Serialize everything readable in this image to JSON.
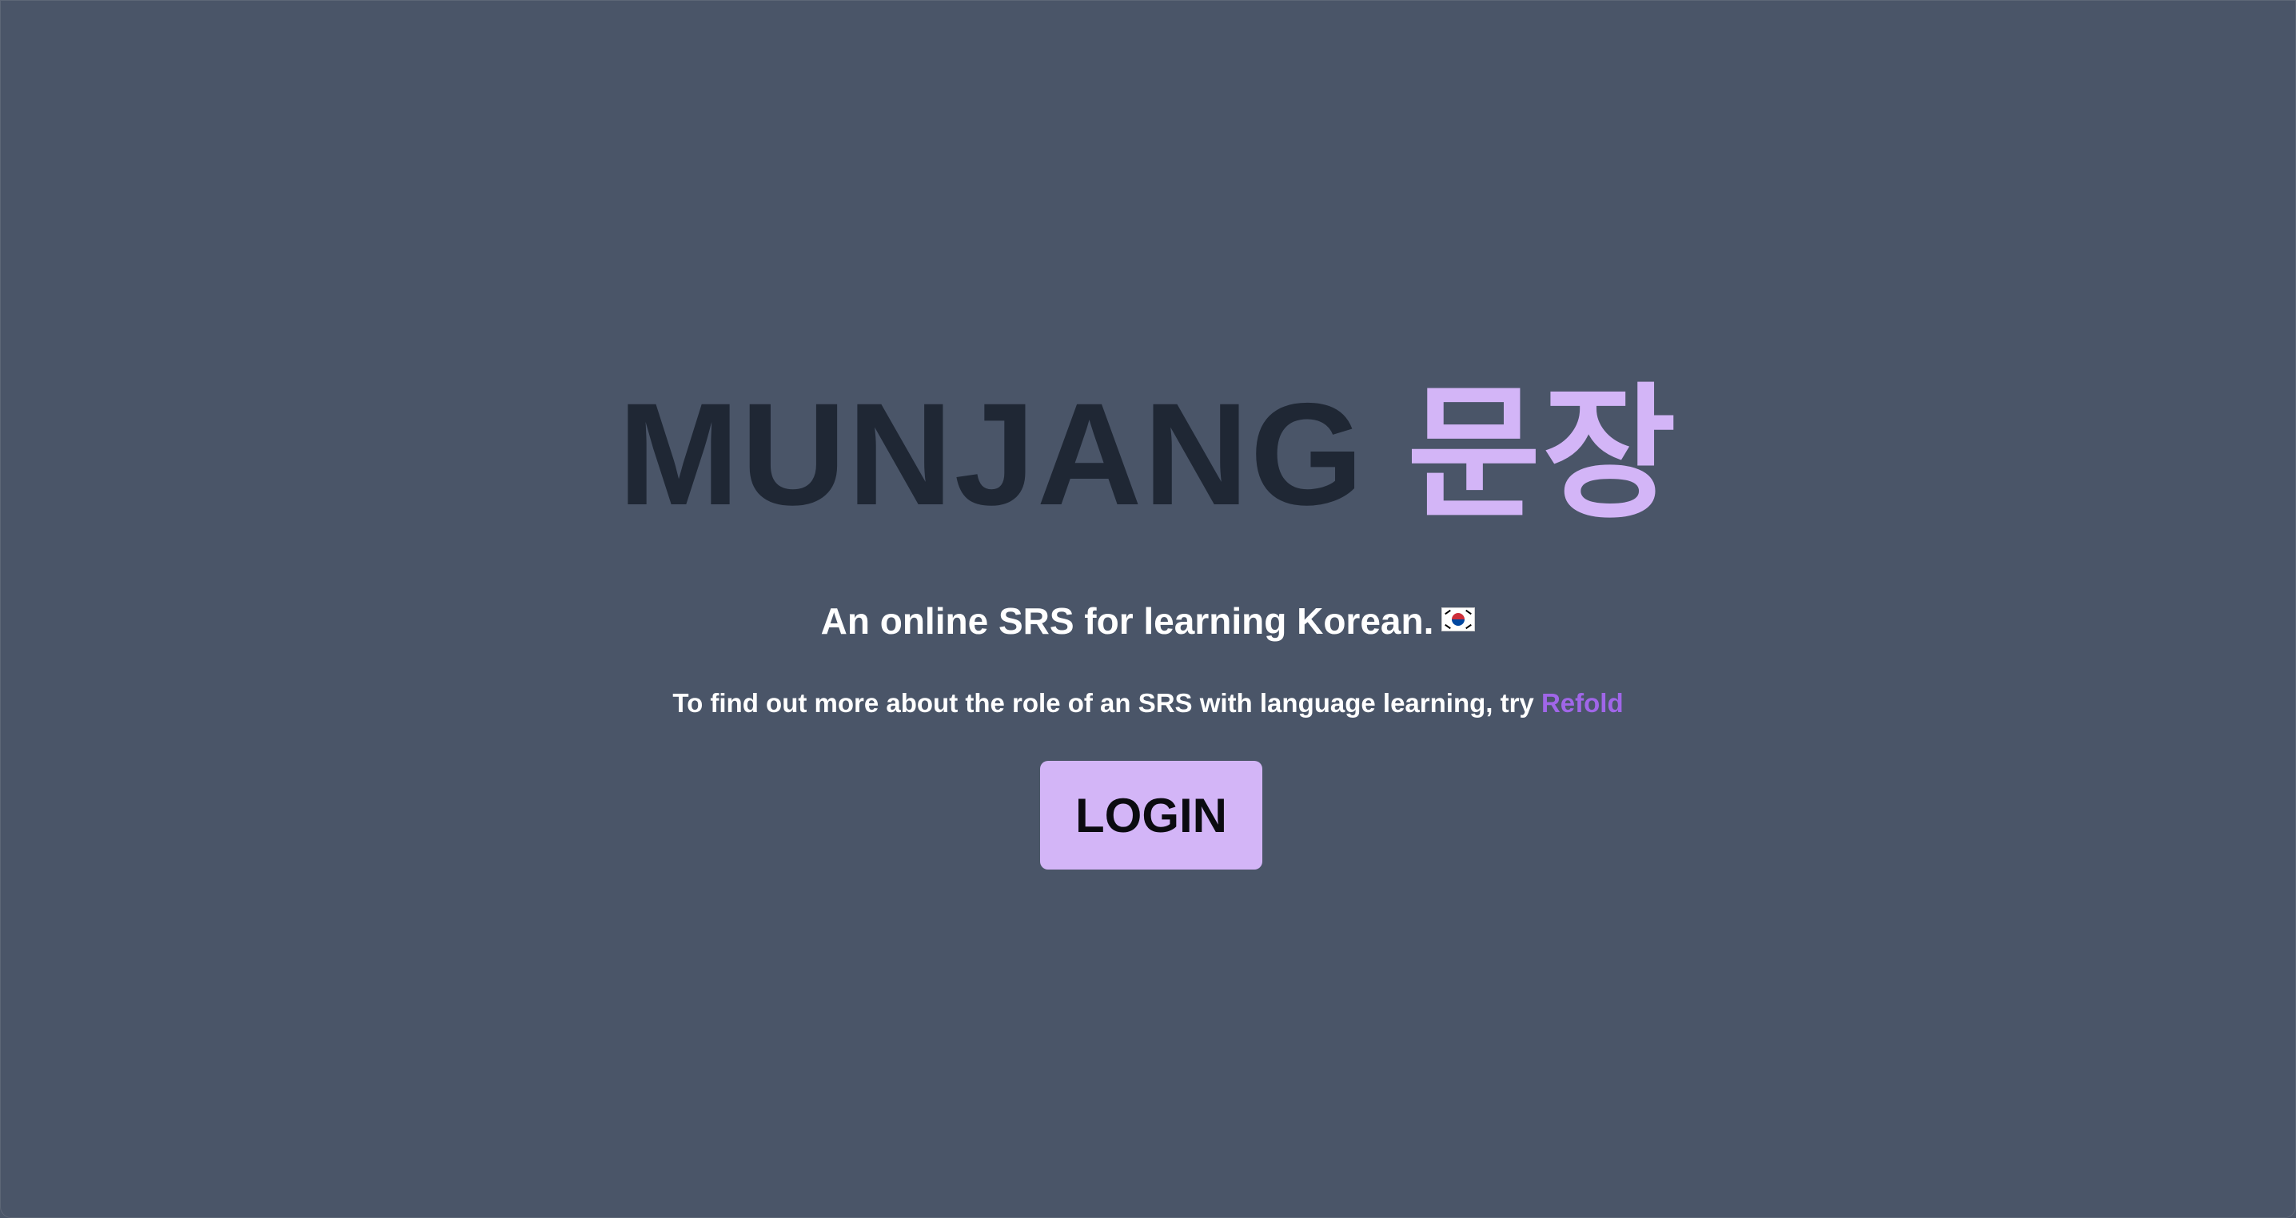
{
  "hero": {
    "title_latin": "MUNJANG",
    "title_hangul": "문장",
    "tagline": "An online SRS for learning Korean.",
    "info_text": "To find out more about the role of an SRS with language learning, try ",
    "info_link": "Refold",
    "login_label": "LOGIN"
  },
  "icons": {
    "flag": "south-korea-flag-icon"
  },
  "colors": {
    "background": "#4a5568",
    "title_dark": "#1f2734",
    "accent": "#d3b5f7",
    "link": "#a066e8",
    "text": "#ffffff"
  }
}
